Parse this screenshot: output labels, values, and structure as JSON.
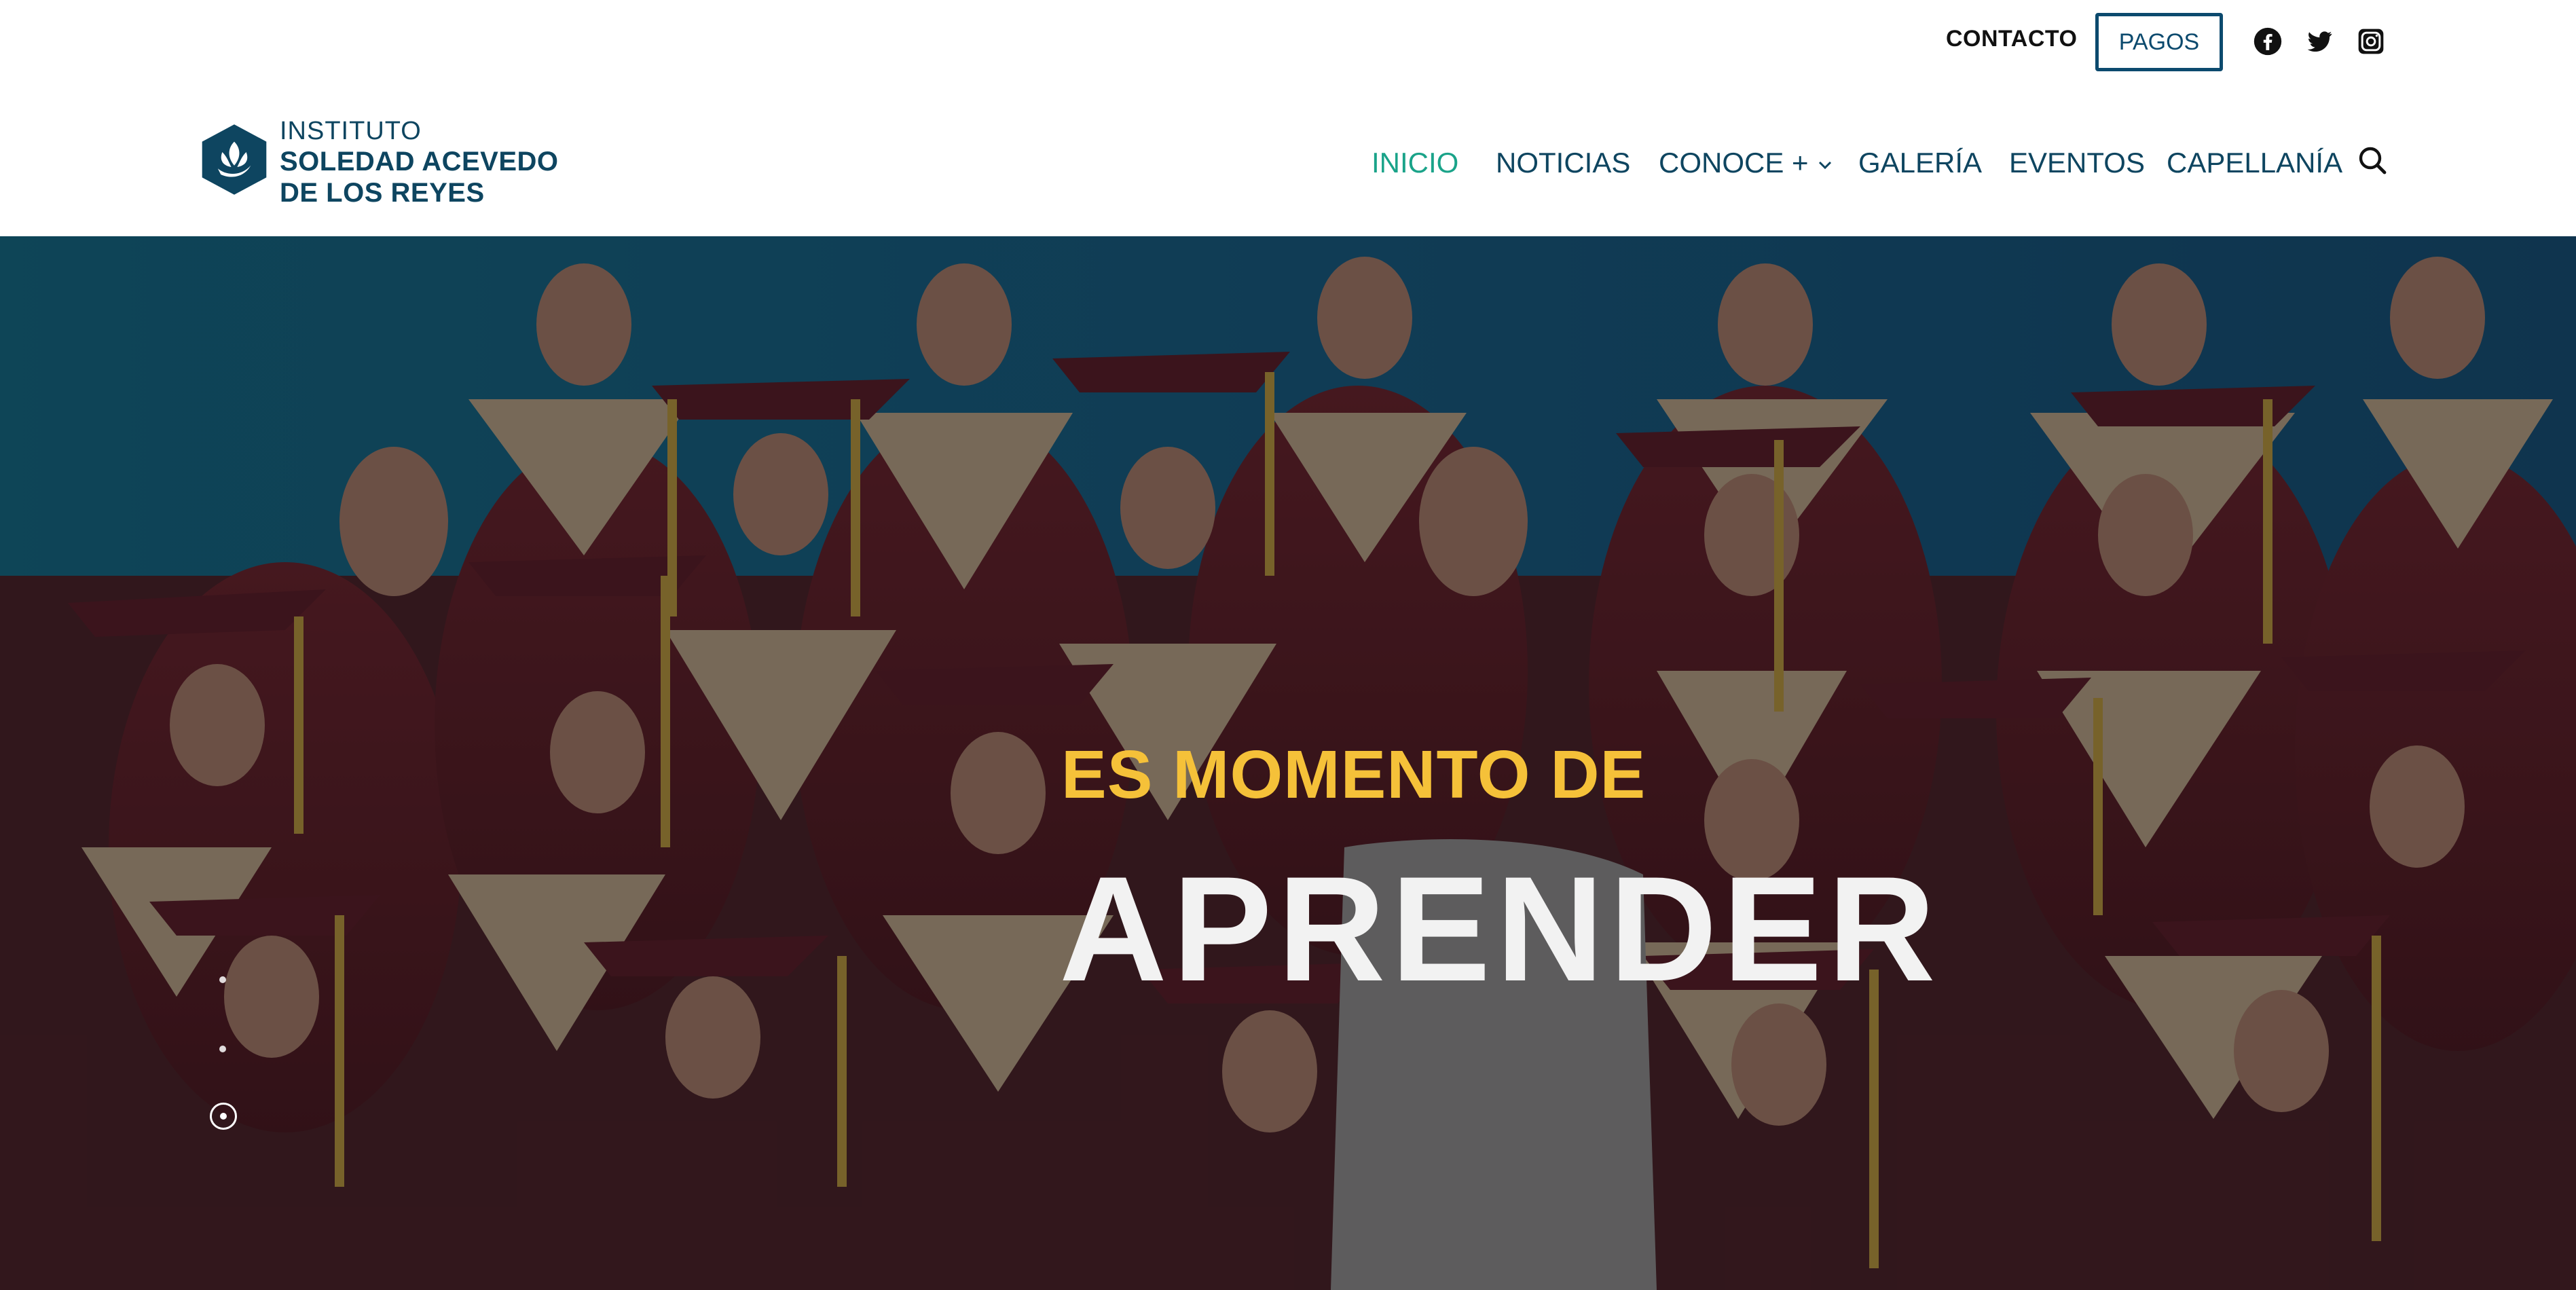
{
  "topbar": {
    "contact_label": "CONTACTO",
    "payments_label": "PAGOS",
    "social": [
      "facebook-icon",
      "twitter-icon",
      "instagram-icon"
    ]
  },
  "logo": {
    "line1": "INSTITUTO",
    "line2": "SOLEDAD ACEVEDO",
    "line3": "DE LOS REYES"
  },
  "nav": {
    "items": [
      {
        "label": "INICIO",
        "active": true
      },
      {
        "label": "NOTICIAS",
        "active": false
      },
      {
        "label": "CONOCE +",
        "active": false,
        "has_dropdown": true
      },
      {
        "label": "GALERÍA",
        "active": false
      },
      {
        "label": "EVENTOS",
        "active": false
      },
      {
        "label": "CAPELLANÍA",
        "active": false
      }
    ]
  },
  "hero": {
    "kicker": "ES MOMENTO DE",
    "headline": "APRENDER",
    "slides_count": 3,
    "active_slide": 3
  },
  "colors": {
    "brand_navy": "#0e4560",
    "active_green": "#1aa389",
    "kicker_yellow": "#f5c139",
    "headline_white": "#f2f2f2"
  }
}
